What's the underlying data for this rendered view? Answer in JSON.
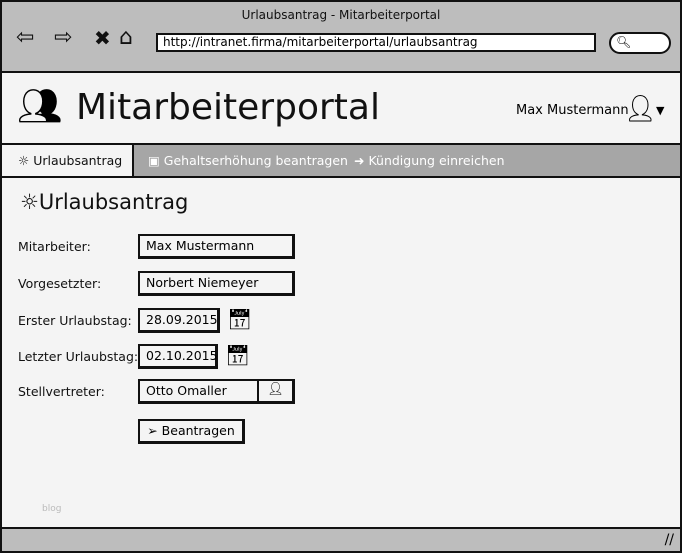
{
  "browser": {
    "title": "Urlaubsantrag - Mitarbeiterportal",
    "url": "http://intranet.firma/mitarbeiterportal/urlaubsantrag"
  },
  "header": {
    "brand": "Mitarbeiterportal",
    "user": "Max Mustermann"
  },
  "tabs": [
    {
      "label": "Urlaubsantrag"
    },
    {
      "label": "Gehaltserhöhung beantragen"
    },
    {
      "label": "Kündigung einreichen"
    }
  ],
  "form": {
    "title": "Urlaubsantrag",
    "employee_label": "Mitarbeiter:",
    "employee": "Max Mustermann",
    "supervisor_label": "Vorgesetzter:",
    "supervisor": "Norbert Niemeyer",
    "first_day_label": "Erster Urlaubstag:",
    "first_day": "28.09.2015",
    "last_day_label": "Letzter Urlaubstag:",
    "last_day": "02.10.2015",
    "deputy_label": "Stellvertreter:",
    "deputy": "Otto Omaller",
    "submit": "Beantragen"
  },
  "footer_text": "blog"
}
